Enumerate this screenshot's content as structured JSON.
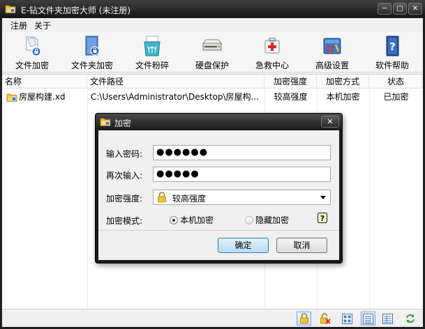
{
  "window": {
    "title": "E-钻文件夹加密大师 (未注册)",
    "controls": {
      "minimize": "─",
      "maximize": "□",
      "close": "✕"
    }
  },
  "menu": [
    {
      "label": "注册"
    },
    {
      "label": "关于"
    }
  ],
  "toolbar": [
    {
      "label": "文件加密",
      "icon": "file-lock-icon"
    },
    {
      "label": "文件夹加密",
      "icon": "folder-lock-icon"
    },
    {
      "label": "文件粉碎",
      "icon": "shredder-icon"
    },
    {
      "label": "硬盘保护",
      "icon": "hard-disk-icon"
    },
    {
      "label": "急救中心",
      "icon": "first-aid-icon"
    },
    {
      "label": "高级设置",
      "icon": "advanced-settings-icon"
    },
    {
      "label": "软件帮助",
      "icon": "help-book-icon"
    }
  ],
  "table": {
    "columns": [
      "名称",
      "文件路径",
      "加密强度",
      "加密方式",
      "状态"
    ],
    "rows": [
      {
        "name": "房屋构建.xd",
        "path": "C:\\Users\\Administrator\\Desktop\\房屋构...",
        "strength": "较高强度",
        "method": "本机加密",
        "status": "已加密"
      }
    ]
  },
  "dialog": {
    "title": "加密",
    "close": "✕",
    "password_label": "输入密码:",
    "password_value": "●●●●●●",
    "confirm_label": "再次输入:",
    "confirm_value": "●●●●●",
    "strength_label": "加密强度:",
    "strength_value": "较高强度",
    "mode_label": "加密模式:",
    "mode_local": "本机加密",
    "mode_hidden": "隐藏加密",
    "help_glyph": "?",
    "ok": "确定",
    "cancel": "取消"
  },
  "colors": {
    "titlebar": "#1f1f1f",
    "primary_button": "#b6d9f4",
    "radio_selected": "#1e3d7a"
  }
}
